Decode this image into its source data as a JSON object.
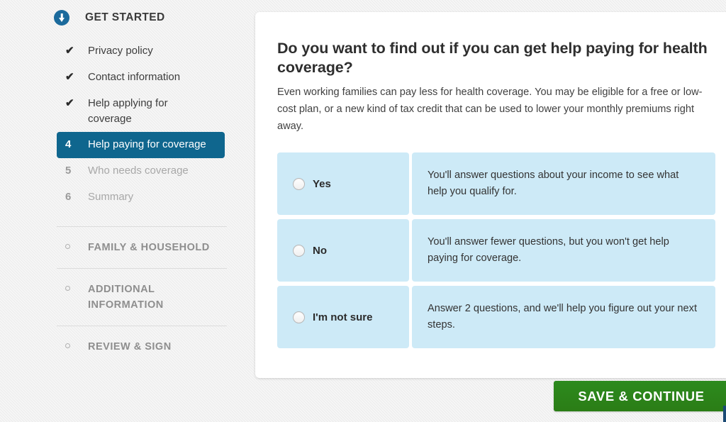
{
  "sidebar": {
    "header": {
      "label": "GET STARTED",
      "icon": "arrow-down-circle-icon"
    },
    "steps": [
      {
        "marker": "✔",
        "label": "Privacy policy",
        "state": "done"
      },
      {
        "marker": "✔",
        "label": "Contact information",
        "state": "done"
      },
      {
        "marker": "✔",
        "label": "Help applying for coverage",
        "state": "done"
      },
      {
        "marker": "4",
        "label": "Help paying for coverage",
        "state": "active"
      },
      {
        "marker": "5",
        "label": "Who needs coverage",
        "state": "pending"
      },
      {
        "marker": "6",
        "label": "Summary",
        "state": "pending"
      }
    ],
    "sections": [
      {
        "label": "FAMILY & HOUSEHOLD",
        "marker": "circle-outline-icon"
      },
      {
        "label": "ADDITIONAL INFORMATION",
        "marker": "circle-outline-icon"
      },
      {
        "label": "REVIEW & SIGN",
        "marker": "circle-outline-icon"
      }
    ]
  },
  "main": {
    "title": "Do you want to find out if you can get help paying for health coverage?",
    "description": "Even working families can pay less for health coverage. You may be eligible for a free or low-cost plan, or a new kind of tax credit that can be used to lower your monthly premiums right away.",
    "options": [
      {
        "label": "Yes",
        "description": "You'll answer questions about your income to see what help you qualify for.",
        "selected": false
      },
      {
        "label": "No",
        "description": "You'll answer fewer questions, but you won't get help paying for coverage.",
        "selected": false
      },
      {
        "label": "I'm not sure",
        "description": "Answer 2 questions, and we'll help you figure out your next steps.",
        "selected": false
      }
    ]
  },
  "footer": {
    "save_label": "SAVE & CONTINUE"
  },
  "colors": {
    "active_step": "#0f668e",
    "option_panel": "#cdeaf7",
    "save_button": "#2b7d16",
    "page_background": "#eeeeee"
  }
}
